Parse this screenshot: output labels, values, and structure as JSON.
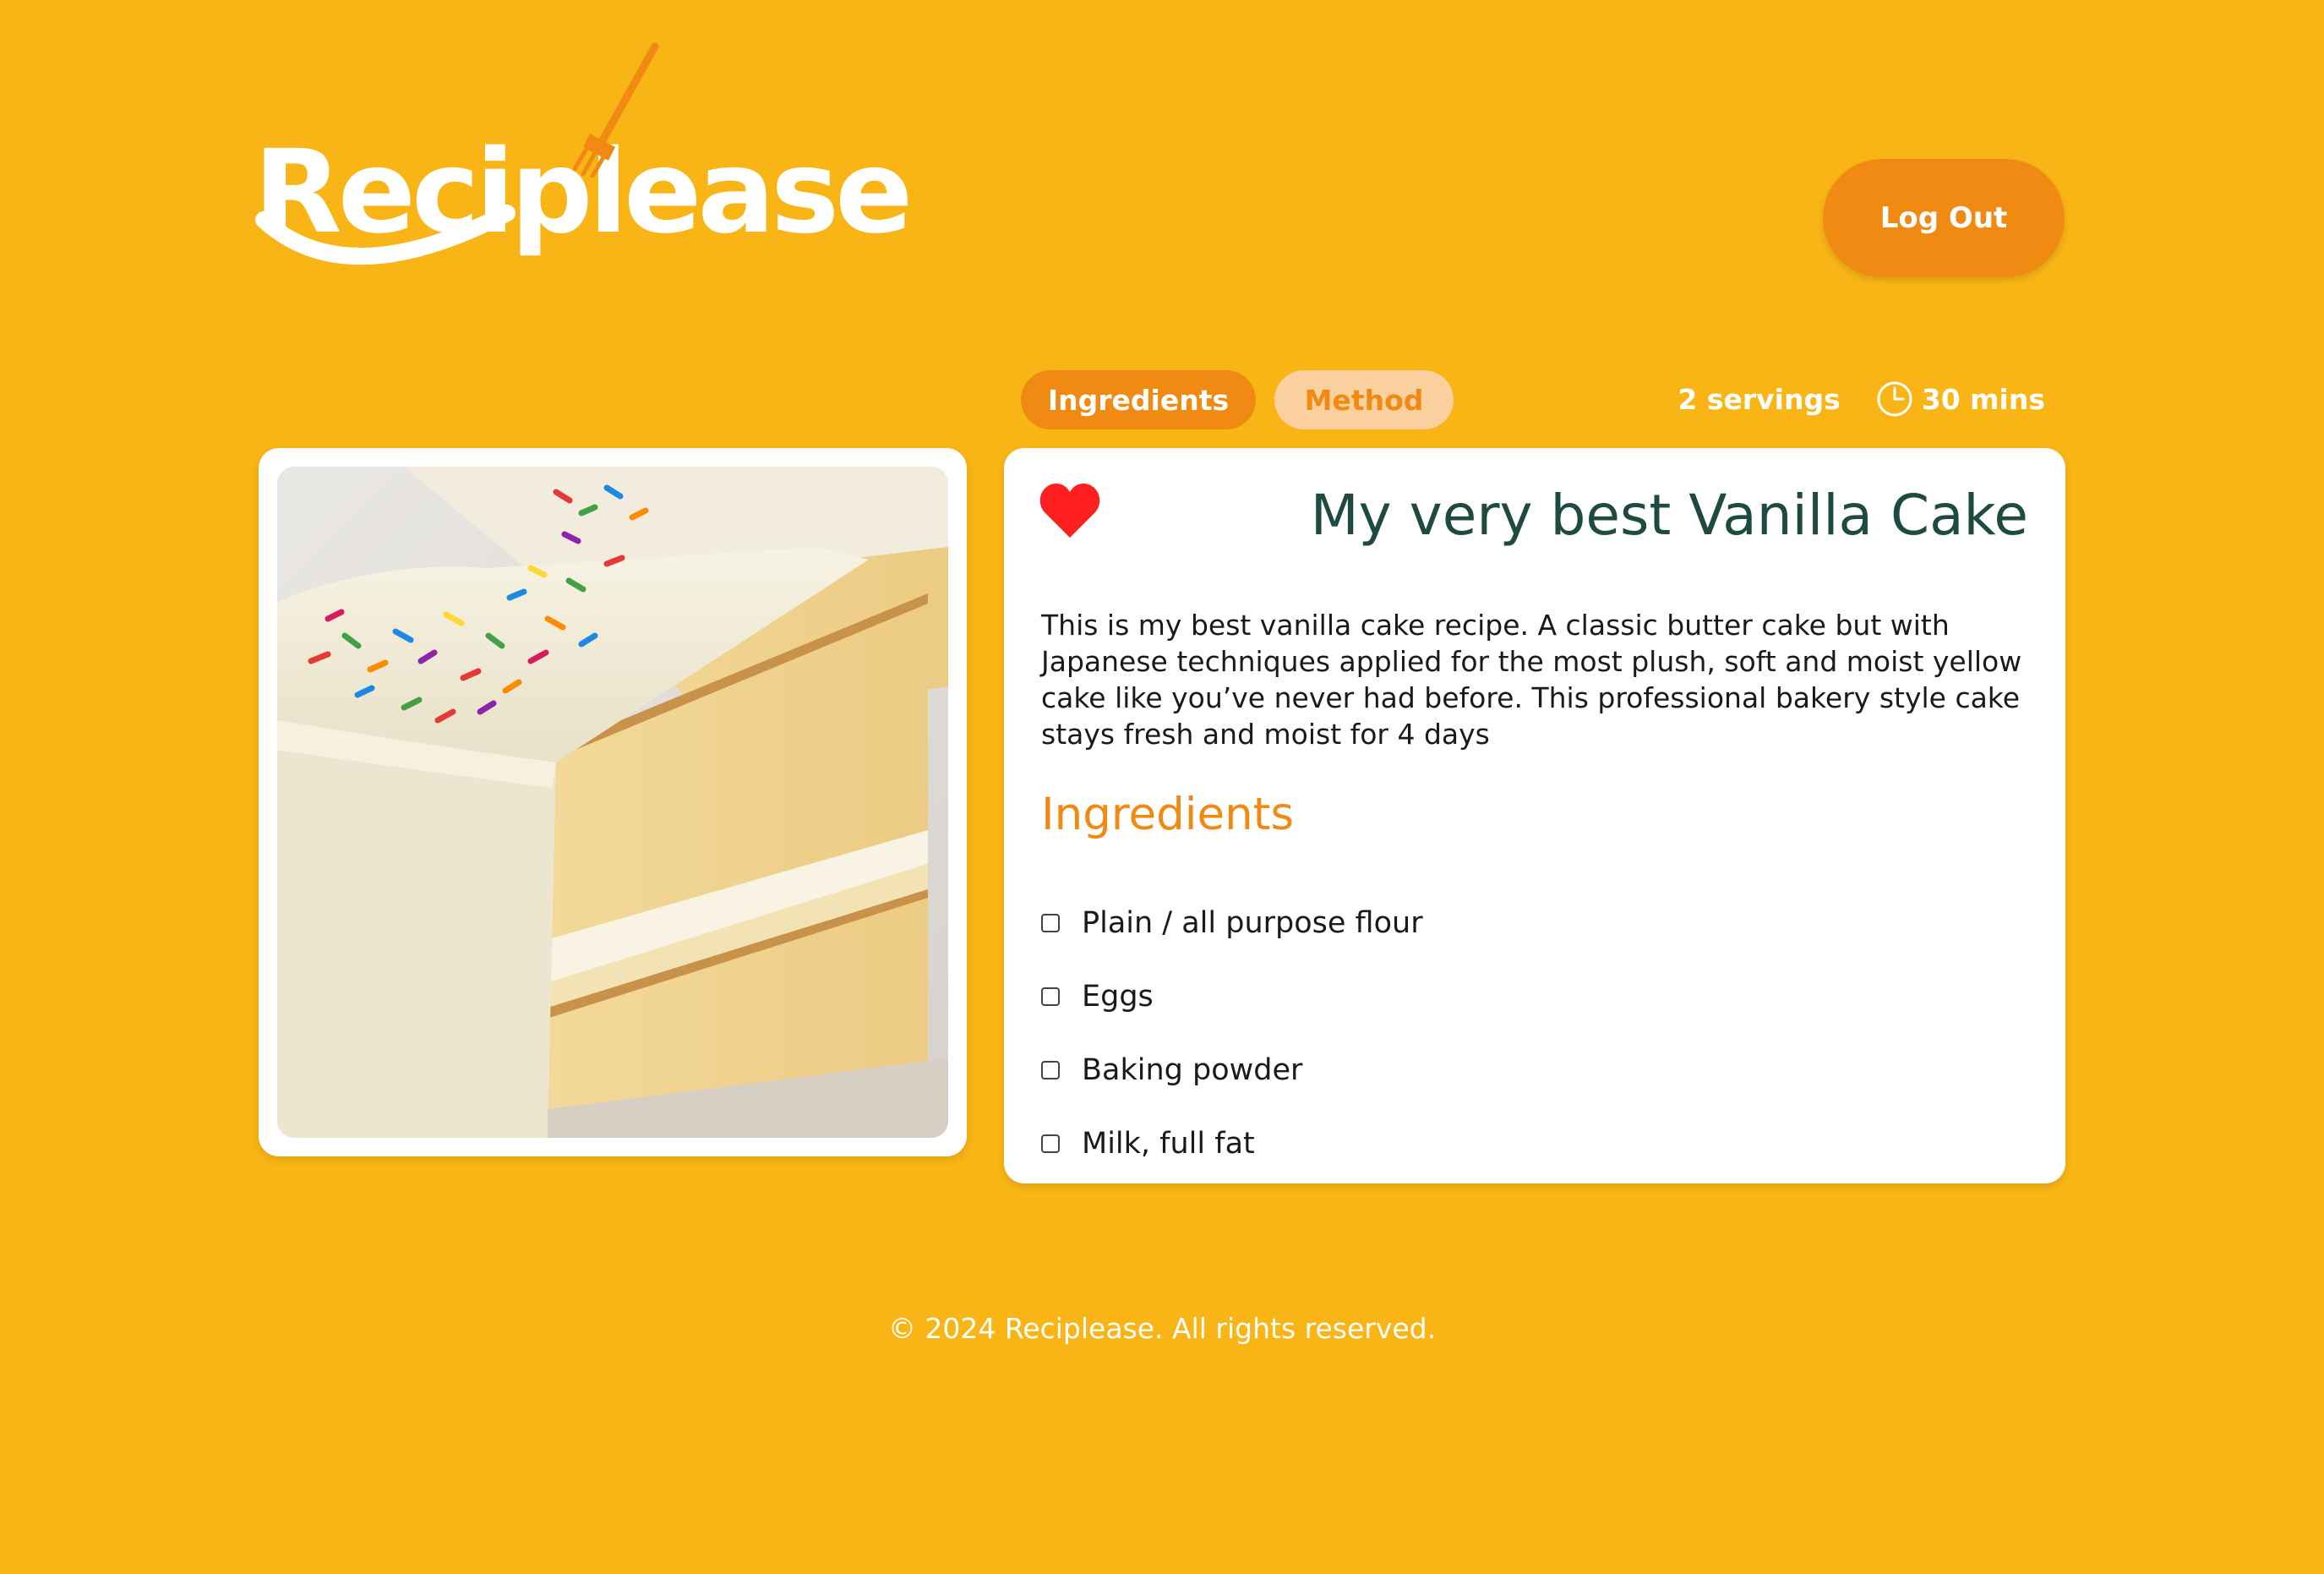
{
  "brand": {
    "name": "Reciplease",
    "colors": {
      "background": "#F8B515",
      "accent": "#F08A12",
      "accent_light": "#FBD09F",
      "title": "#1E4A42",
      "heart": "#FF1F1F"
    }
  },
  "header": {
    "logout_label": "Log Out"
  },
  "tabs": [
    {
      "label": "Ingredients",
      "active": true
    },
    {
      "label": "Method",
      "active": false
    }
  ],
  "meta": {
    "servings": "2 servings",
    "time": "30 mins",
    "time_icon": "clock-icon"
  },
  "image": {
    "icon": "cake-photo"
  },
  "recipe": {
    "favorite_icon": "heart-icon",
    "title": "My very best Vanilla Cake",
    "description": "This is my best vanilla cake recipe. A classic butter cake but with Japanese techniques applied for the most plush, soft and moist yellow cake like you’ve never had before. This professional bakery style cake stays fresh and moist for 4 days",
    "ingredients_heading": "Ingredients",
    "ingredients": [
      {
        "label": "Plain / all purpose flour",
        "checked": false
      },
      {
        "label": "Eggs",
        "checked": false
      },
      {
        "label": "Baking powder",
        "checked": false
      },
      {
        "label": "Milk, full fat",
        "checked": false
      }
    ]
  },
  "footer": {
    "text": "© 2024 Reciplease. All rights reserved."
  }
}
